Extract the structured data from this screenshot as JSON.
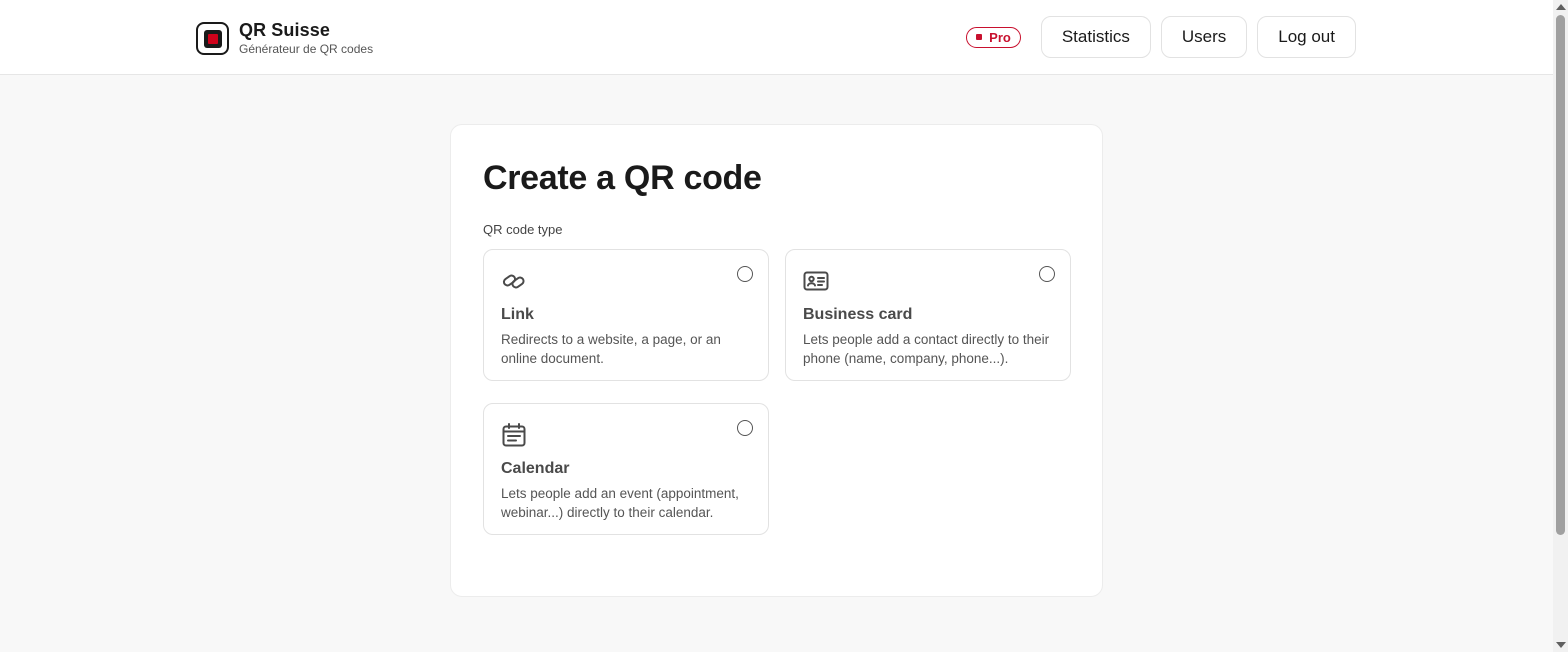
{
  "header": {
    "brand_title": "QR Suisse",
    "brand_subtitle": "Générateur de QR codes",
    "badge": "Pro",
    "nav": {
      "statistics": "Statistics",
      "users": "Users",
      "logout": "Log out"
    }
  },
  "main": {
    "title": "Create a QR code",
    "type_label": "QR code type",
    "options": [
      {
        "icon": "link-icon",
        "title": "Link",
        "description": "Redirects to a website, a page, or an online document."
      },
      {
        "icon": "id-card-icon",
        "title": "Business card",
        "description": "Lets people add a contact directly to their phone (name, company, phone...)."
      },
      {
        "icon": "calendar-icon",
        "title": "Calendar",
        "description": "Lets people add an event (appointment, webinar...) directly to their calendar."
      }
    ]
  },
  "colors": {
    "accent": "#c8102e",
    "text": "#1a1a1a",
    "background": "#f8f8f8"
  }
}
